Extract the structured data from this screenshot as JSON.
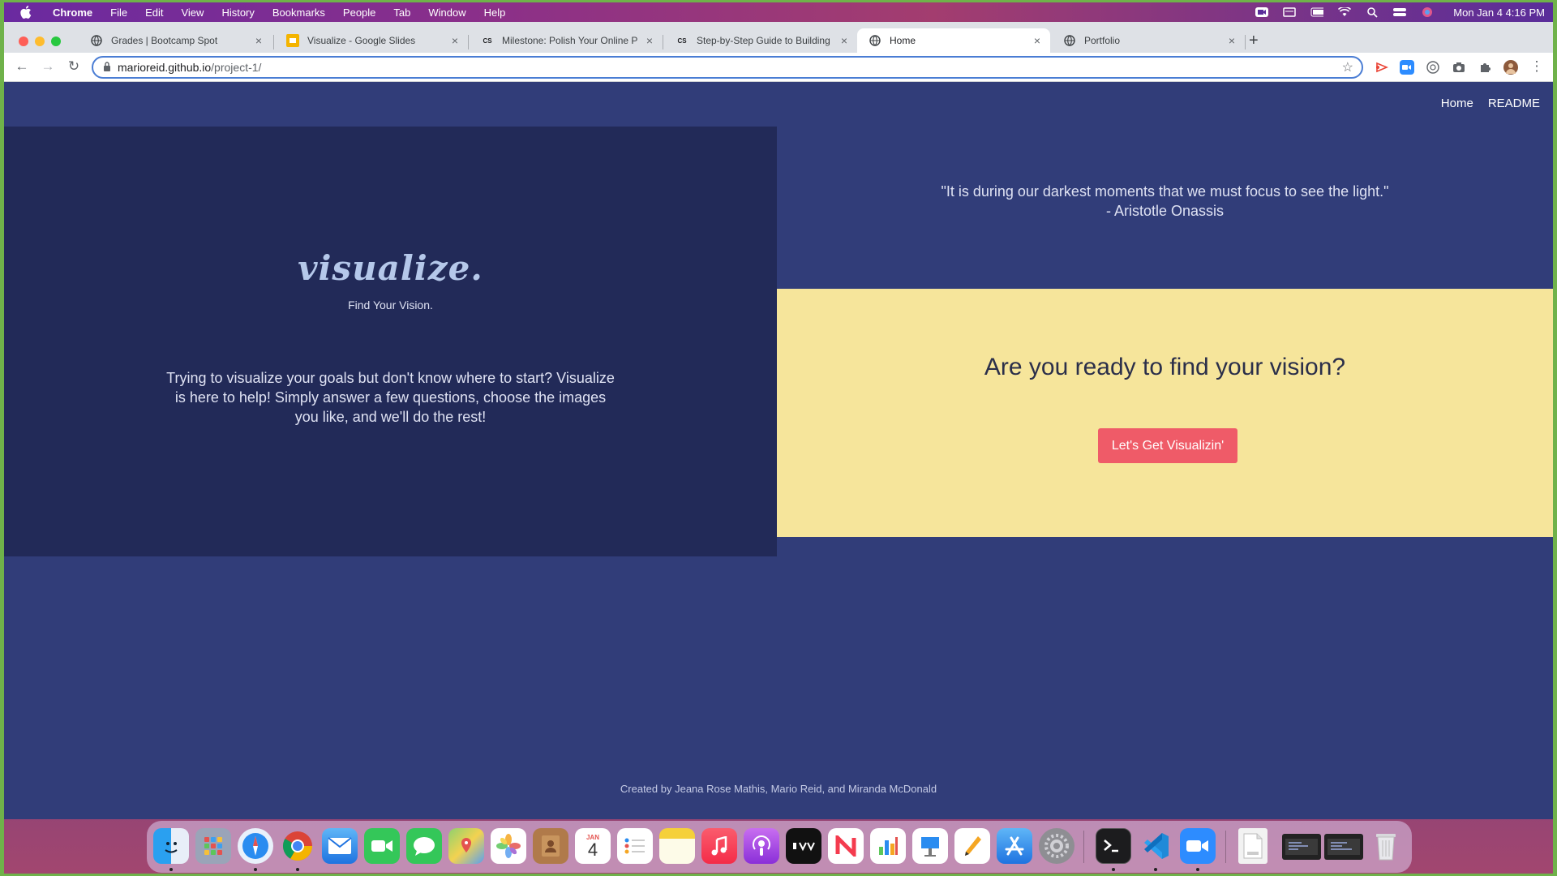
{
  "menubar": {
    "apple_icon": "apple-logo",
    "items": [
      "Chrome",
      "File",
      "Edit",
      "View",
      "History",
      "Bookmarks",
      "People",
      "Tab",
      "Window",
      "Help"
    ],
    "status_icons": [
      "zoom-status-icon",
      "display-icon",
      "battery-icon",
      "wifi-icon",
      "search-icon",
      "control-center-icon",
      "siri-icon"
    ],
    "clock": "Mon Jan 4  4:16 PM"
  },
  "tabs": [
    {
      "title": "Grades | Bootcamp Spot",
      "icon": "globe-icon",
      "active": false
    },
    {
      "title": "Visualize - Google Slides",
      "icon": "slides-icon",
      "active": false
    },
    {
      "title": "Milestone: Polish Your Online P",
      "icon": "cs-icon",
      "active": false
    },
    {
      "title": "Step-by-Step Guide to Building",
      "icon": "cs-icon",
      "active": false
    },
    {
      "title": "Home",
      "icon": "globe-icon",
      "active": true
    },
    {
      "title": "Portfolio",
      "icon": "globe-icon",
      "active": false
    }
  ],
  "tab_close": "×",
  "cs_badge": "CS",
  "new_tab": "+",
  "toolbar": {
    "back": "←",
    "forward": "→",
    "reload": "↻",
    "url_host": "marioreid.github.io",
    "url_path": "/project-1/",
    "bookmark": "☆",
    "menu": "⋮"
  },
  "site": {
    "nav": [
      "Home",
      "README"
    ],
    "logo": "visualize.",
    "tagline": "Find Your Vision.",
    "intro": "Trying to visualize your goals but don't know where to start? Visualize is here to help! Simply answer a few questions, choose the images you like, and we'll do the rest!",
    "quote": "\"It is during our darkest moments that we must focus to see the light.\"",
    "quote_author": "- Aristotle Onassis",
    "cta_heading": "Are you ready to find your vision?",
    "cta_button": "Let's Get Visualizin'",
    "footer": "Created by Jeana Rose Mathis, Mario Reid, and Miranda McDonald"
  },
  "dock": {
    "calendar_month": "JAN",
    "calendar_day": "4",
    "apps": [
      "Finder",
      "Launchpad",
      "Safari",
      "Chrome",
      "Mail",
      "FaceTime",
      "Messages",
      "Maps",
      "Photos",
      "Contacts",
      "Calendar",
      "Reminders",
      "Notes",
      "Music",
      "Podcasts",
      "TV",
      "News",
      "Numbers",
      "Keynote",
      "Pages",
      "App Store",
      "System Preferences",
      "Terminal",
      "VS Code",
      "Zoom",
      "PDF Document",
      "Screenshot",
      "Screenshot",
      "Trash"
    ]
  },
  "colors": {
    "page_bg": "#313d79",
    "left_panel": "#222a58",
    "cta_panel": "#f6e59b",
    "cta_button": "#ef5b68",
    "logo": "#b5c8ea"
  }
}
